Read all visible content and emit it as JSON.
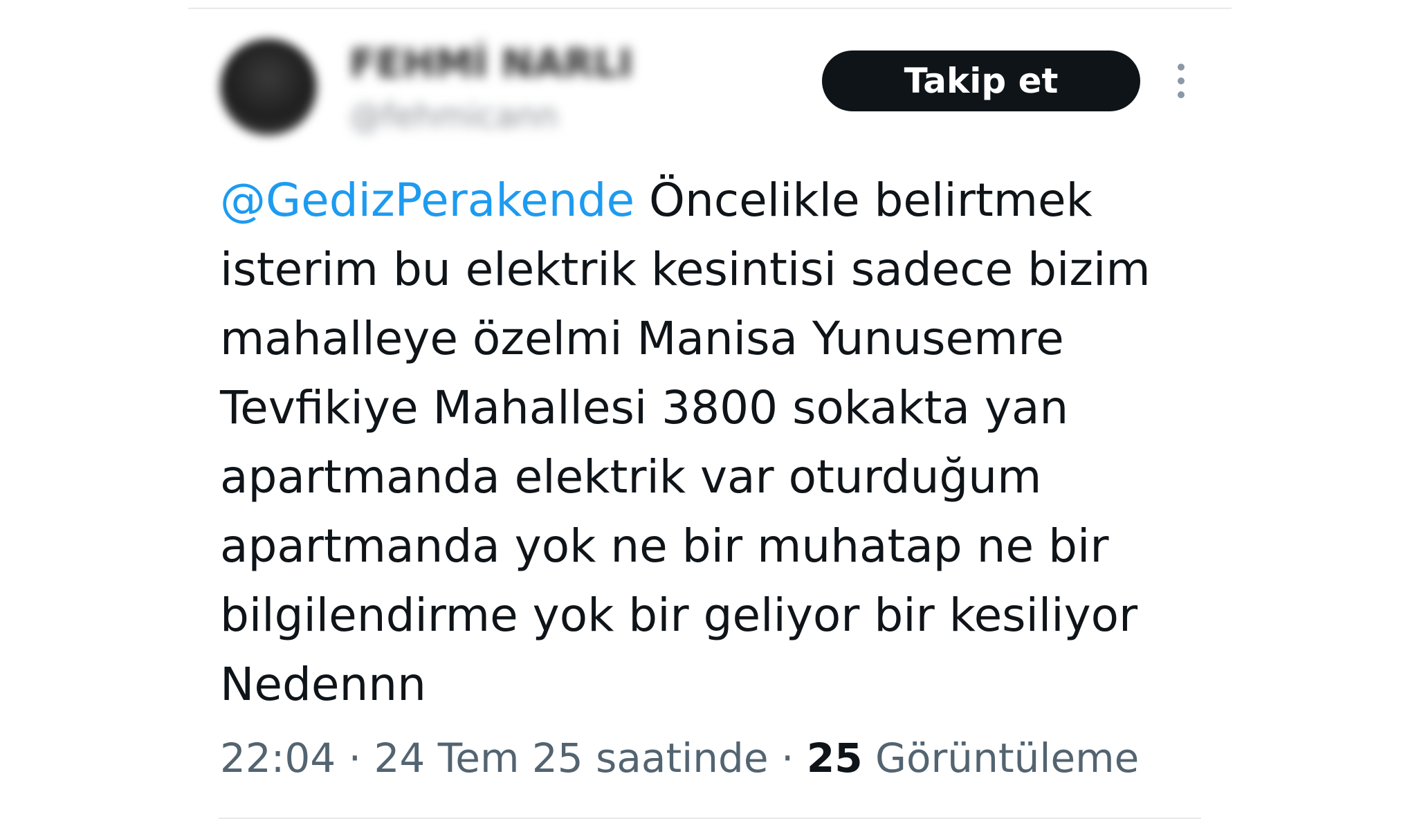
{
  "author": {
    "name": "FEHMİ NARLI",
    "handle": "@fehmicann"
  },
  "follow_button": {
    "label": "Takip et"
  },
  "more_menu": {
    "icon": "more-vertical-icon"
  },
  "tweet": {
    "mention": "@GedizPerakende",
    "text": " Öncelikle belirtmek isterim bu elektrik kesintisi sadece bizim mahalleye özelmi Manisa Yunusemre Tevfikiye Mahallesi 3800 sokakta yan apartmanda elektrik var oturduğum apartmanda yok ne bir muhatap ne bir bilgilendirme yok bir geliyor bir kesiliyor Nedennn"
  },
  "meta": {
    "time": "22:04",
    "separator": " · ",
    "date": "24 Tem 25 saatinde",
    "views_count": "25",
    "views_label": "Görüntüleme"
  },
  "colors": {
    "mention": "#1d9bf0",
    "text": "#0f1419",
    "secondary": "#536471",
    "button_bg": "#0f1419",
    "divider": "#e6e8ea"
  }
}
